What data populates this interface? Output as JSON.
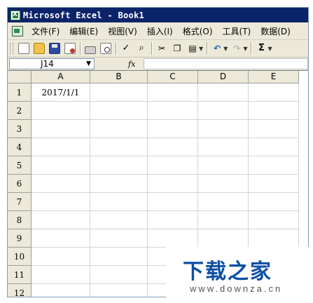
{
  "window": {
    "title": "Microsoft Excel - Book1",
    "icon": "excel-app-icon"
  },
  "menu": {
    "items": [
      {
        "label": "文件(F)"
      },
      {
        "label": "编辑(E)"
      },
      {
        "label": "视图(V)"
      },
      {
        "label": "插入(I)"
      },
      {
        "label": "格式(O)"
      },
      {
        "label": "工具(T)"
      },
      {
        "label": "数据(D)"
      }
    ]
  },
  "toolbar": {
    "icons": [
      "new-document-icon",
      "open-folder-icon",
      "save-icon",
      "permission-icon",
      "print-icon",
      "print-preview-icon",
      "spelling-icon",
      "research-icon",
      "cut-icon",
      "copy-icon",
      "paste-icon",
      "undo-icon",
      "redo-icon",
      "autosum-icon"
    ],
    "sum_label": "Σ"
  },
  "formula_bar": {
    "name_box": "J14",
    "fx_label": "fx",
    "formula": ""
  },
  "sheet": {
    "columns": [
      "A",
      "B",
      "C",
      "D",
      "E"
    ],
    "rows": [
      "1",
      "2",
      "3",
      "4",
      "5",
      "6",
      "7",
      "8",
      "9",
      "10",
      "11",
      "12"
    ],
    "cells": {
      "A1": "2017/1/1"
    }
  },
  "watermark": {
    "title": "下载之家",
    "url": "www.downza.cn"
  }
}
